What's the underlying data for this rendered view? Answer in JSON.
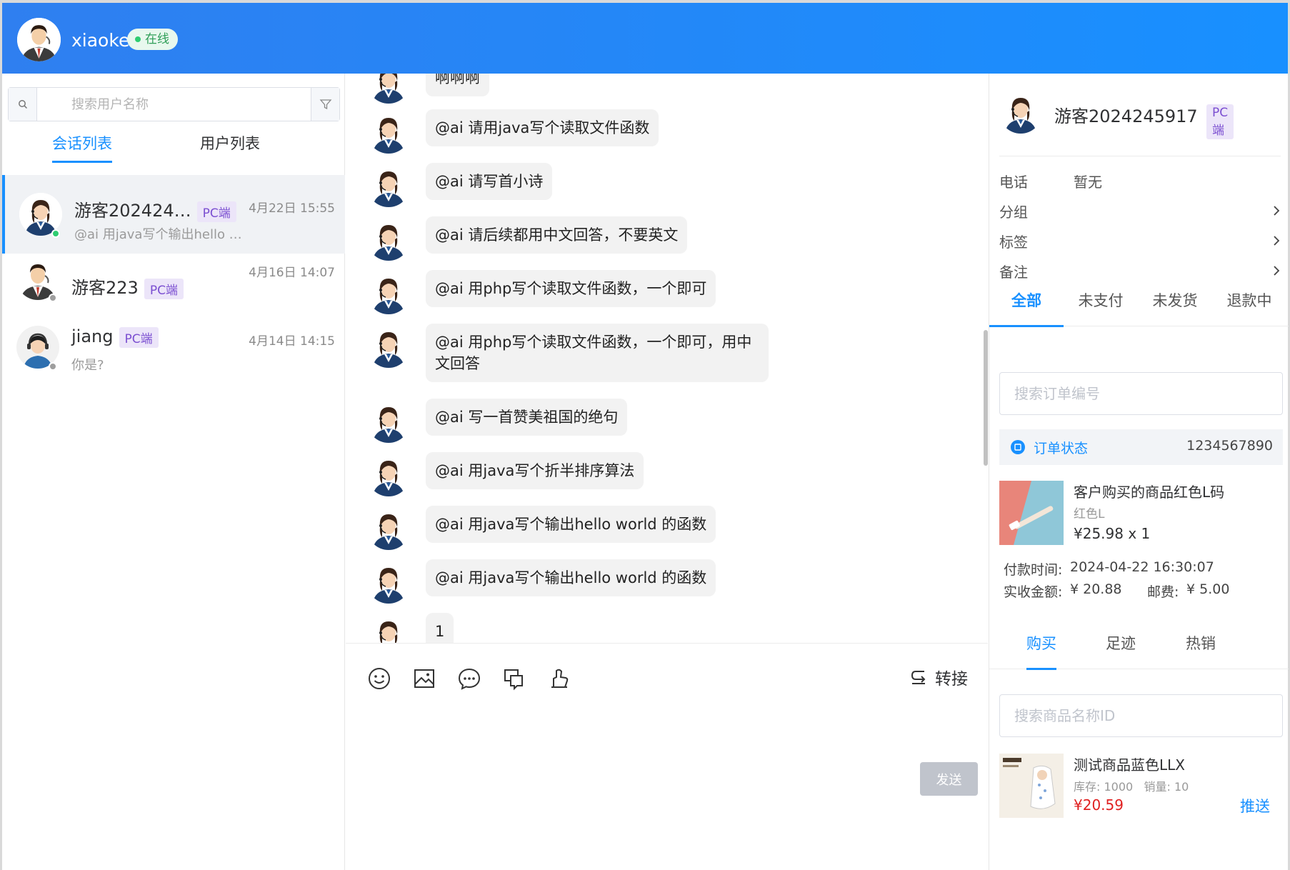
{
  "header": {
    "username": "xiaoke",
    "status": "在线"
  },
  "left": {
    "search_placeholder": "搜索用户名称",
    "tabs": [
      {
        "label": "会话列表",
        "active": true
      },
      {
        "label": "用户列表",
        "active": false
      }
    ],
    "conversations": [
      {
        "name": "游客202424…",
        "platform": "PC端",
        "time": "4月22日 15:55",
        "preview": "@ai 用java写个输出hello …",
        "online": true,
        "active": true
      },
      {
        "name": "游客223",
        "platform": "PC端",
        "time": "4月16日 14:07",
        "preview": "",
        "online": false,
        "active": false
      },
      {
        "name": "jiang",
        "platform": "PC端",
        "time": "4月14日 14:15",
        "preview": "你是?",
        "online": false,
        "active": false
      }
    ]
  },
  "chat": {
    "messages": [
      "啊啊啊",
      "@ai 请用java写个读取文件函数",
      "@ai 请写首小诗",
      "@ai 请后续都用中文回答，不要英文",
      "@ai 用php写个读取文件函数，一个即可",
      "@ai 用php写个读取文件函数，一个即可，用中文回答",
      "@ai 写一首赞美祖国的绝句",
      "@ai 用java写个折半排序算法",
      "@ai 用java写个输出hello world 的函数",
      "@ai 用java写个输出hello world 的函数",
      "1"
    ],
    "toolbar": {
      "transfer_label": "转接",
      "icons": [
        "emoji-icon",
        "image-icon",
        "quick-reply-icon",
        "history-icon",
        "rate-icon"
      ]
    },
    "send_label": "发送"
  },
  "right": {
    "customer": {
      "name": "游客2024245917",
      "platform": "PC端"
    },
    "info": [
      {
        "label": "电话",
        "value": "暂无",
        "chevron": false
      },
      {
        "label": "分组",
        "value": "",
        "chevron": true
      },
      {
        "label": "标签",
        "value": "",
        "chevron": true
      },
      {
        "label": "备注",
        "value": "",
        "chevron": true
      }
    ],
    "order_tabs": [
      {
        "label": "全部",
        "active": true
      },
      {
        "label": "未支付",
        "active": false
      },
      {
        "label": "未发货",
        "active": false
      },
      {
        "label": "退款中",
        "active": false
      }
    ],
    "order_search_placeholder": "搜索订单编号",
    "order": {
      "status_label": "订单状态",
      "number": "1234567890",
      "product_name": "客户购买的商品红色L码",
      "sku": "红色L",
      "price_qty": "¥25.98 x 1",
      "pay_time_label": "付款时间:",
      "pay_time": "2024-04-22 16:30:07",
      "amount_label": "实收金额:",
      "amount": "¥ 20.88",
      "postage_label": "邮费:",
      "postage": "¥ 5.00"
    },
    "goods_tabs": [
      {
        "label": "购买",
        "active": true
      },
      {
        "label": "足迹",
        "active": false
      },
      {
        "label": "热销",
        "active": false
      }
    ],
    "goods_search_placeholder": "搜索商品名称ID",
    "goods": {
      "name": "测试商品蓝色LLX",
      "stock_label": "库存:",
      "stock": "1000",
      "sales_label": "销量:",
      "sales": "10",
      "price": "¥20.59",
      "push_label": "推送"
    }
  },
  "colors": {
    "accent": "#1890ff",
    "header_gradient_start": "#2f7ff0",
    "online": "#2ecc71",
    "offline": "#9e9e9e",
    "price_red": "#e02020",
    "pc_tag_bg": "#ece5f9",
    "pc_tag_text": "#7b4fd1"
  }
}
